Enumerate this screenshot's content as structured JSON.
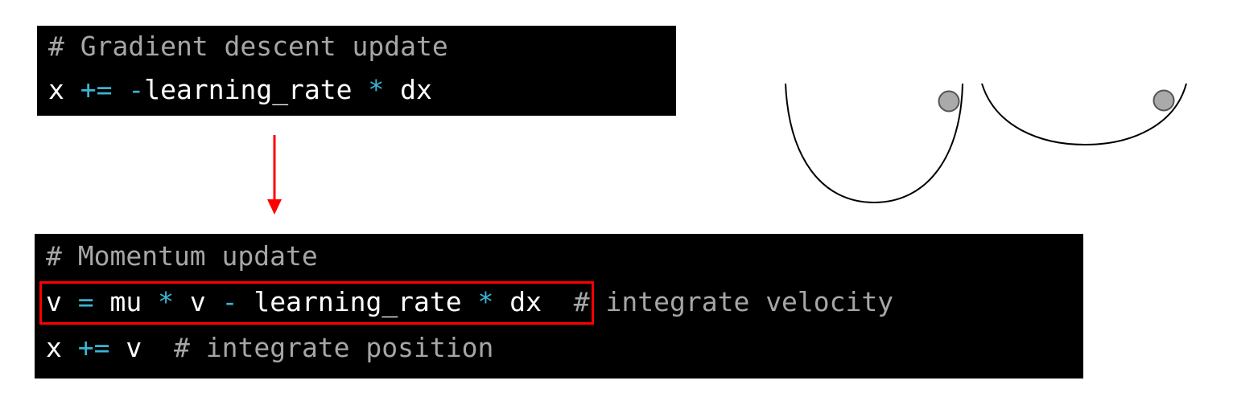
{
  "gradient_block": {
    "comment": "# Gradient descent update",
    "line2": {
      "var": "x",
      "op1": "+=",
      "op2": "-",
      "term": "learning_rate",
      "op3": "*",
      "grad": "dx"
    }
  },
  "momentum_block": {
    "comment": "# Momentum update",
    "line2": {
      "v1": "v",
      "eq": "=",
      "mu": "mu",
      "star1": "*",
      "v2": "v",
      "minus": "-",
      "lr": "learning_rate",
      "star2": "*",
      "dx": "dx",
      "comment": "# integrate velocity"
    },
    "line3": {
      "x": "x",
      "op": "+=",
      "v": "v",
      "comment": "# integrate position"
    }
  },
  "colors": {
    "code_bg": "#000000",
    "comment": "#a6a6a6",
    "operator": "#3cb4d2",
    "text": "#ffffff",
    "highlight": "#ff0000",
    "arrow": "#ff0000",
    "ball_fill": "#aaaaaa"
  },
  "icons": {
    "arrow": "down-arrow-icon",
    "narrow_bowl": "narrow-bowl-with-ball",
    "wide_bowl": "wide-bowl-with-ball"
  }
}
